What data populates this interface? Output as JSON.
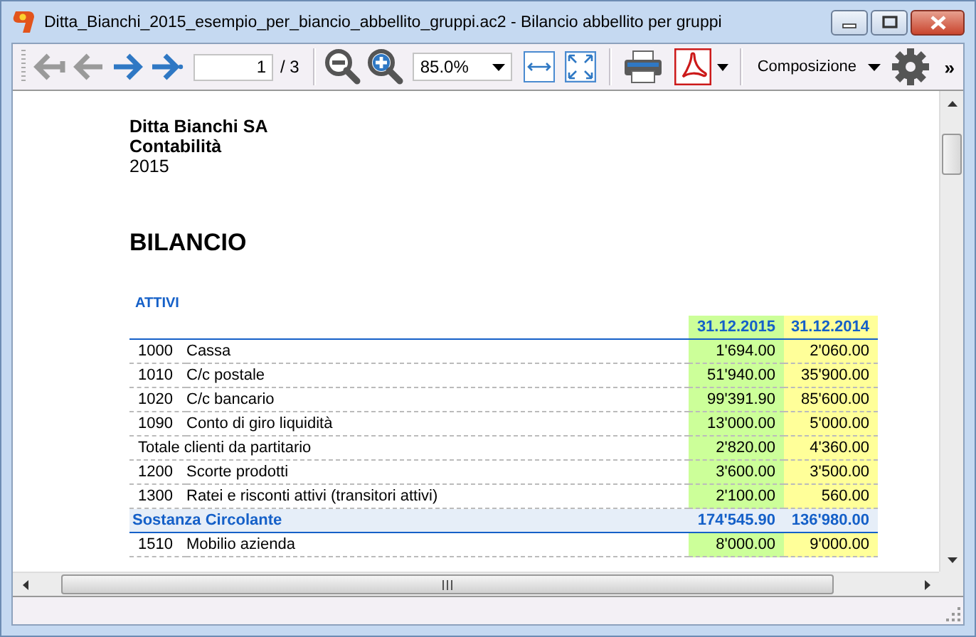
{
  "window": {
    "title": "Ditta_Bianchi_2015_esempio_per_biancio_abbellito_gruppi.ac2 - Bilancio abbellito per gruppi"
  },
  "toolbar": {
    "navigation": [
      {
        "kind": "first",
        "disabled": true
      },
      {
        "kind": "previous",
        "disabled": true
      },
      {
        "kind": "next",
        "disabled": false
      },
      {
        "kind": "last",
        "disabled": false
      }
    ],
    "page_field": {
      "value": "1"
    },
    "page_total": "/ 3",
    "zoom": {
      "value": "85.0%"
    },
    "menu_label": "Composizione",
    "overflow": "»"
  },
  "report": {
    "company": "Ditta Bianchi SA",
    "subtitle": "Contabilità",
    "year": "2015",
    "title": "BILANCIO",
    "section": "ATTIVI",
    "columns": [
      "31.12.2015",
      "31.12.2014"
    ],
    "rows": [
      {
        "kind": "account",
        "code": "1000",
        "description": "Cassa",
        "values": [
          "1'694.00",
          "2'060.00"
        ]
      },
      {
        "kind": "account",
        "code": "1010",
        "description": "C/c postale",
        "values": [
          "51'940.00",
          "35'900.00"
        ]
      },
      {
        "kind": "account",
        "code": "1020",
        "description": "C/c bancario",
        "values": [
          "99'391.90",
          "85'600.00"
        ]
      },
      {
        "kind": "account",
        "code": "1090",
        "description": "Conto di giro liquidità",
        "values": [
          "13'000.00",
          "5'000.00"
        ]
      },
      {
        "kind": "total",
        "description": "Totale clienti da partitario",
        "values": [
          "2'820.00",
          "4'360.00"
        ]
      },
      {
        "kind": "account",
        "code": "1200",
        "description": "Scorte prodotti",
        "values": [
          "3'600.00",
          "3'500.00"
        ]
      },
      {
        "kind": "account",
        "code": "1300",
        "description": "Ratei e risconti attivi (transitori attivi)",
        "values": [
          "2'100.00",
          "560.00"
        ]
      },
      {
        "kind": "group",
        "description": "Sostanza Circolante",
        "values": [
          "174'545.90",
          "136'980.00"
        ]
      },
      {
        "kind": "account",
        "code": "1510",
        "description": "Mobilio azienda",
        "values": [
          "8'000.00",
          "9'000.00"
        ]
      }
    ]
  }
}
